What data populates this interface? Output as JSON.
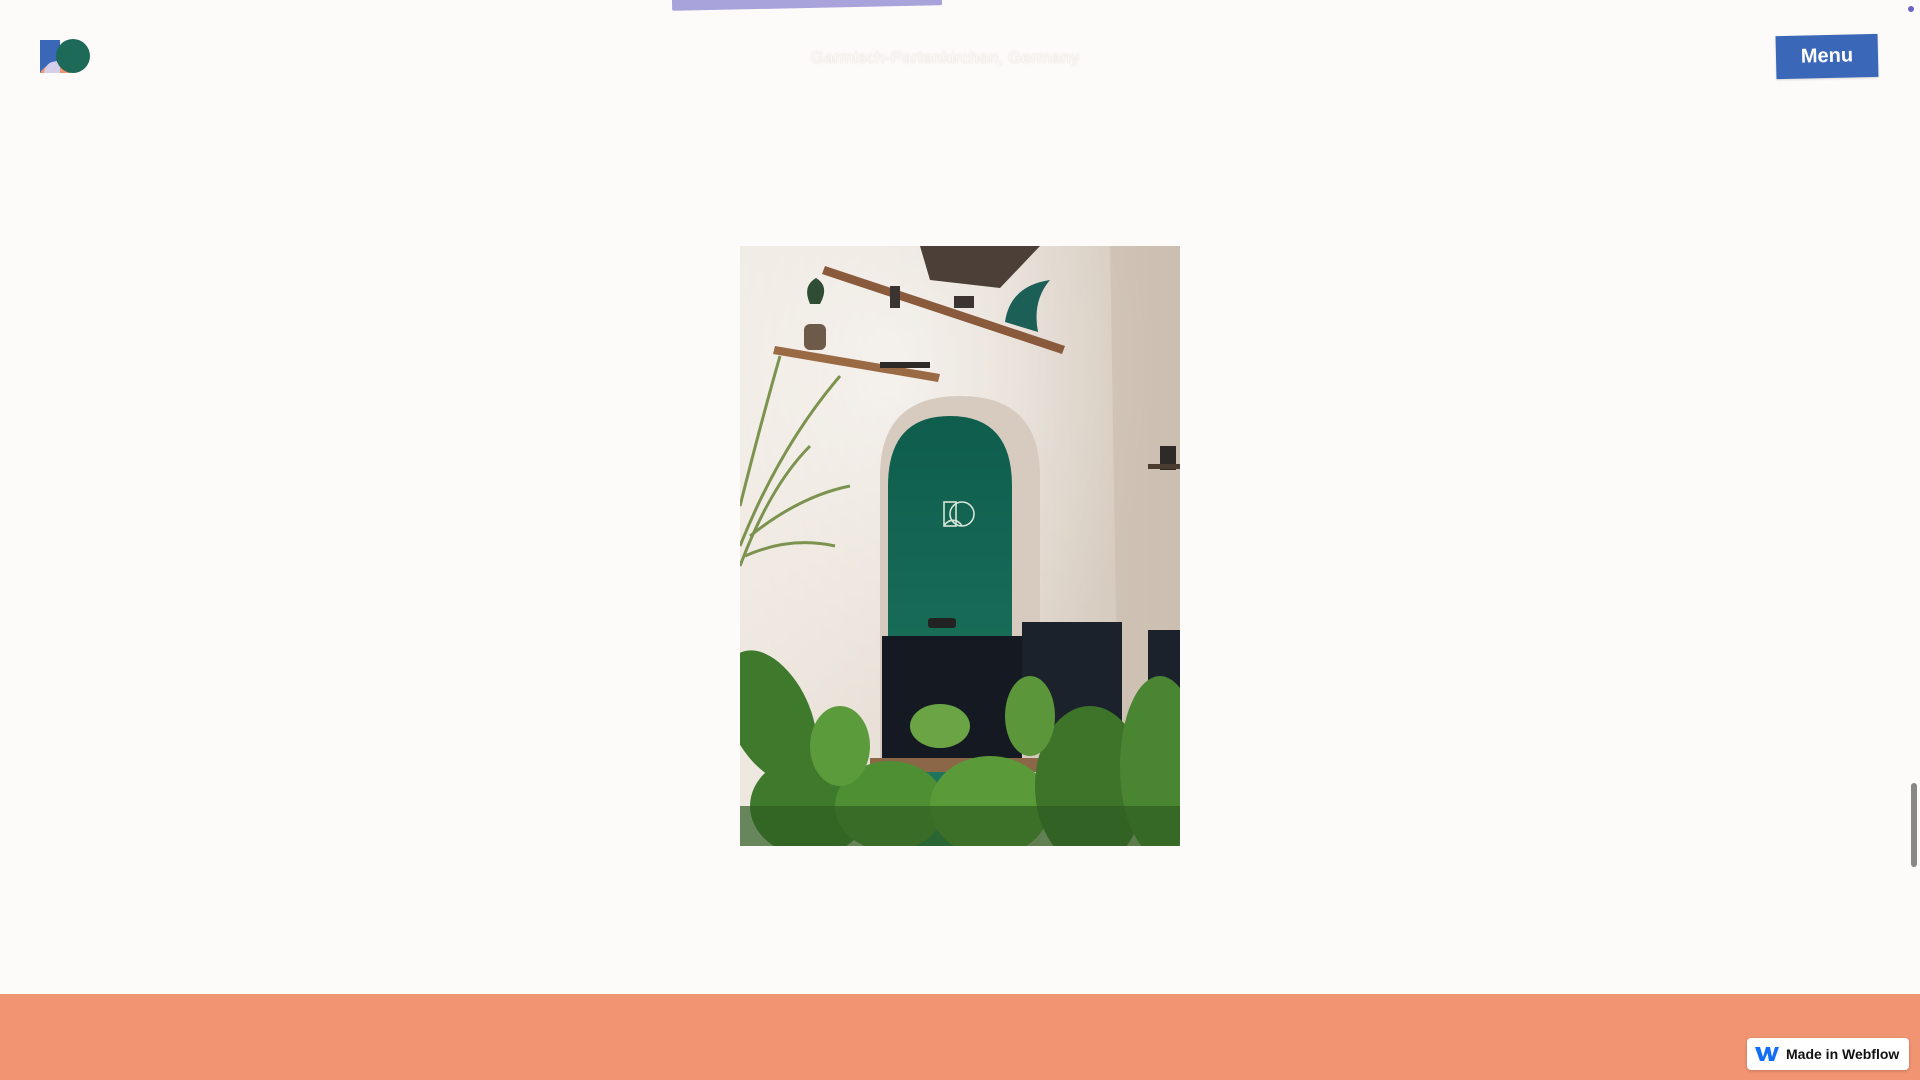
{
  "header": {
    "logo_icon": "studio-logo-icon",
    "location": "Garmisch-Partenkirchen, Germany",
    "menu_label": "Menu"
  },
  "photo": {
    "alt": "Office interior with green arched alcove, wall shelves, monitors and plants"
  },
  "badge": {
    "label": "Made in Webflow",
    "icon": "webflow-icon"
  },
  "colors": {
    "background": "#fdfbf9",
    "menu_button": "#3a67b8",
    "footer_band": "#f19472",
    "accent_purple": "#a9a3dc",
    "alcove_green": "#1d6a58"
  }
}
